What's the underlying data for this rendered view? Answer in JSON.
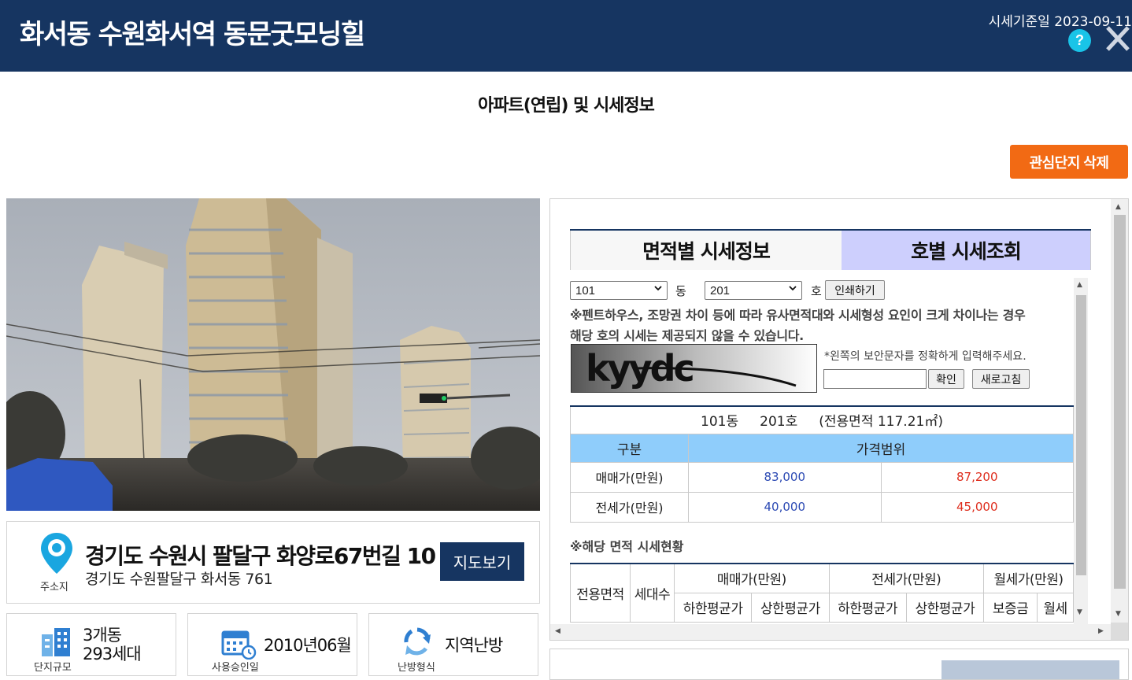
{
  "header": {
    "title": "화서동 수원화서역 동문굿모닝힐",
    "price_base_date": "시세기준일 2023-09-11",
    "help_icon": "question-circle-icon",
    "close_icon": "close-icon",
    "background_color": "#163561"
  },
  "section_title": "아파트(연립) 및 시세정보",
  "actions": {
    "delete_interest": "관심단지 삭제"
  },
  "address": {
    "label": "주소지",
    "road": "경기도 수원시 팔달구 화양로67번길 10",
    "jibun": "경기도 수원팔달구 화서동 761",
    "map_button": "지도보기"
  },
  "info_cards": [
    {
      "icon": "building-icon",
      "line1": "3개동",
      "line2": "293세대",
      "label": "단지규모"
    },
    {
      "icon": "calendar-icon",
      "value": "2010년06월",
      "label": "사용승인일"
    },
    {
      "icon": "recycle-arrows-icon",
      "value": "지역난방",
      "label": "난방형식"
    }
  ],
  "tabs": [
    {
      "label": "면적별 시세정보",
      "active": false
    },
    {
      "label": "호별 시세조회",
      "active": true
    }
  ],
  "unit_search": {
    "dong_value": "101",
    "dong_unit": "동",
    "ho_value": "201",
    "ho_unit": "호",
    "print_button": "인쇄하기",
    "notice_line1": "※펜트하우스, 조망권 차이 등에 따라 유사면적대와 시세형성 요인이 크게 차이나는 경우",
    "notice_line2": "해당 호의 시세는 제공되지 않을 수 있습니다.",
    "captcha_text": "kyydc",
    "captcha_hint": "*왼쪽의 보안문자를 정확하게 입력해주세요.",
    "captcha_input": "",
    "confirm_button": "확인",
    "refresh_button": "새로고침"
  },
  "result": {
    "dong": "101동",
    "ho": "201호",
    "area": "(전용면적 117.21㎡)",
    "col_category": "구분",
    "col_range": "가격범위",
    "rows": [
      {
        "label": "매매가(만원)",
        "low": "83,000",
        "high": "87,200"
      },
      {
        "label": "전세가(만원)",
        "low": "40,000",
        "high": "45,000"
      }
    ]
  },
  "area_status": {
    "notice": "※해당 면적 시세현황",
    "col_area": "전용면적",
    "col_households": "세대수",
    "group_sale": "매매가(만원)",
    "group_jeonse": "전세가(만원)",
    "group_monthly": "월세가(만원)",
    "sub_low_avg_sale": "하한평균가",
    "sub_high_avg_sale": "상한평균가",
    "sub_low_avg_jeonse": "하한평균가",
    "sub_high_avg_jeonse": "상한평균가",
    "sub_deposit": "보증금",
    "sub_monthly": "월세"
  },
  "colors": {
    "accent_orange": "#f26a14",
    "active_tab": "#cdcffd",
    "table_header": "#8fcdfb",
    "low_price": "#2b49b3",
    "high_price": "#de2d1d"
  }
}
